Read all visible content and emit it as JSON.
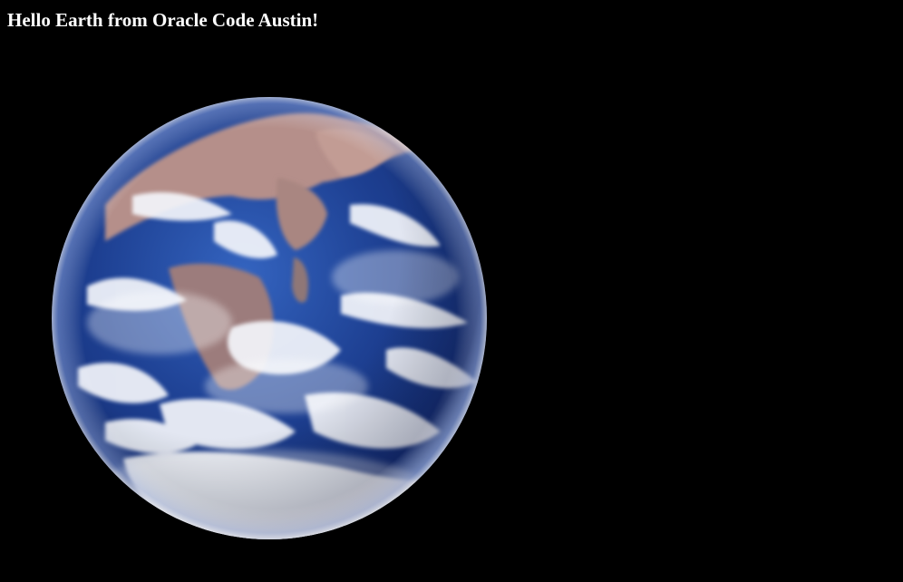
{
  "page": {
    "title": "Hello Earth from Oracle Code Austin!",
    "background_color": "#000000",
    "title_color": "#ffffff"
  },
  "earth_image": {
    "icon": "earth-globe-photo",
    "ocean_color": "#1d3f91",
    "land_color": "#b58f8a",
    "cloud_color": "#f4f6fb"
  }
}
